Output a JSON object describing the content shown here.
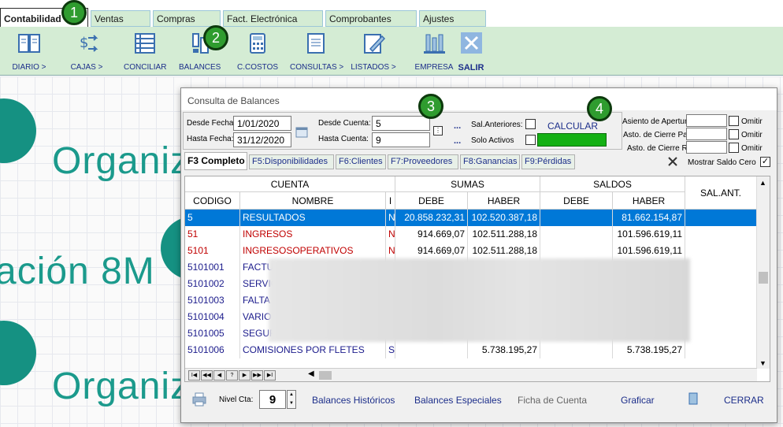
{
  "tabs": [
    {
      "label": "Contabilidad",
      "active": true
    },
    {
      "label": "Ventas"
    },
    {
      "label": "Compras"
    },
    {
      "label": "Fact. Electrónica"
    },
    {
      "label": "Comprobantes"
    },
    {
      "label": "Ajustes"
    }
  ],
  "toolbar": [
    {
      "label": "DIARIO >",
      "icon": "book-icon"
    },
    {
      "label": "CAJAS >",
      "icon": "money-exchange-icon"
    },
    {
      "label": "CONCILIAR",
      "icon": "list-icon"
    },
    {
      "label": "BALANCES",
      "icon": "balance-icon"
    },
    {
      "label": "C.COSTOS",
      "icon": "calculator-icon"
    },
    {
      "label": "CONSULTAS >",
      "icon": "document-icon"
    },
    {
      "label": "LISTADOS >",
      "icon": "pencil-icon"
    },
    {
      "label": "EMPRESA",
      "icon": "building-icon"
    },
    {
      "label": "SALIR",
      "icon": "close-icon"
    }
  ],
  "badges": [
    "1",
    "2",
    "3",
    "4"
  ],
  "background": {
    "text1": "Organiz",
    "text2": "ación 8M",
    "text3": "Organiz"
  },
  "dialog": {
    "title": "Consulta de Balances",
    "desde_fecha_label": "Desde Fecha:",
    "desde_fecha": "1/01/2020",
    "hasta_fecha_label": "Hasta Fecha:",
    "hasta_fecha": "31/12/2020",
    "desde_cuenta_label": "Desde Cuenta:",
    "desde_cuenta": "5",
    "hasta_cuenta_label": "Hasta Cuenta:",
    "hasta_cuenta": "9",
    "sal_anteriores_label": "Sal.Anteriores:",
    "solo_activos_label": "Solo Activos",
    "calcular_label": "CALCULAR",
    "asiento_apertura_label": "Asiento de Apertura",
    "asto_cierre_patr_label": "Asto. de Cierre Patr.",
    "asto_cierre_res_label": "Asto. de Cierre Res",
    "omitir_label": "Omitir",
    "mostrar_saldo_cero_label": "Mostrar Saldo Cero",
    "ellipsis": "..."
  },
  "filter_tabs": [
    {
      "label": "F3 Completo",
      "active": true
    },
    {
      "label": "F5:Disponibilidades"
    },
    {
      "label": "F6:Clientes"
    },
    {
      "label": "F7:Proveedores"
    },
    {
      "label": "F8:Ganancias"
    },
    {
      "label": "F9:Pérdidas"
    }
  ],
  "grid": {
    "group_headers": {
      "cuenta": "CUENTA",
      "sumas": "SUMAS",
      "saldos": "SALDOS",
      "sal_ant": "SAL.ANT."
    },
    "columns": {
      "codigo": "CODIGO",
      "nombre": "NOMBRE",
      "i": "I",
      "debe": "DEBE",
      "haber": "HABER",
      "sdebe": "DEBE",
      "shaber": "HABER"
    },
    "rows": [
      {
        "codigo": "5",
        "nombre": "RESULTADOS",
        "i": "N",
        "debe": "20.858.232,31",
        "haber": "102.520.387,18",
        "sdebe": "",
        "shaber": "81.662.154,87",
        "style": "selected"
      },
      {
        "codigo": "51",
        "nombre": "INGRESOS",
        "i": "N",
        "debe": "914.669,07",
        "haber": "102.511.288,18",
        "sdebe": "",
        "shaber": "101.596.619,11",
        "style": "red"
      },
      {
        "codigo": "5101",
        "nombre": "INGRESOSOPERATIVOS",
        "i": "N",
        "debe": "914.669,07",
        "haber": "102.511.288,18",
        "sdebe": "",
        "shaber": "101.596.619,11",
        "style": "red"
      },
      {
        "codigo": "5101001",
        "nombre": "FACTU",
        "i": "",
        "debe": "",
        "haber": "",
        "sdebe": "",
        "shaber": "",
        "style": "blue"
      },
      {
        "codigo": "5101002",
        "nombre": "SERVIC",
        "i": "",
        "debe": "",
        "haber": "",
        "sdebe": "",
        "shaber": "",
        "style": "blue"
      },
      {
        "codigo": "5101003",
        "nombre": "FALTA",
        "i": "",
        "debe": "",
        "haber": "",
        "sdebe": "",
        "shaber": "",
        "style": "blue"
      },
      {
        "codigo": "5101004",
        "nombre": "VARIO",
        "i": "",
        "debe": "",
        "haber": "",
        "sdebe": "",
        "shaber": "",
        "style": "blue"
      },
      {
        "codigo": "5101005",
        "nombre": "SEGUR",
        "i": "",
        "debe": "",
        "haber": "",
        "sdebe": "",
        "shaber": "",
        "style": "blue"
      },
      {
        "codigo": "5101006",
        "nombre": "COMISIONES POR FLETES",
        "i": "S",
        "debe": "",
        "haber": "5.738.195,27",
        "sdebe": "",
        "shaber": "5.738.195,27",
        "style": "blue"
      }
    ]
  },
  "footer": {
    "nivel_label": "Nivel Cta:",
    "nivel_value": "9",
    "historicos": "Balances Históricos",
    "especiales": "Balances Especiales",
    "ficha": "Ficha de Cuenta",
    "graficar": "Graficar",
    "cerrar": "CERRAR"
  },
  "nav_buttons": [
    "I◀",
    "◀◀",
    "◀",
    "?",
    "▶",
    "▶▶",
    "▶I"
  ]
}
